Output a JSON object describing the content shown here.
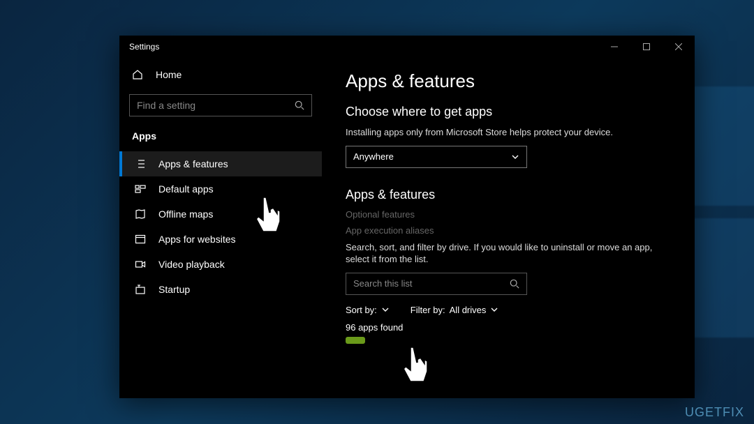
{
  "window": {
    "title": "Settings"
  },
  "sidebar": {
    "home_label": "Home",
    "search_placeholder": "Find a setting",
    "category": "Apps",
    "items": [
      {
        "label": "Apps & features"
      },
      {
        "label": "Default apps"
      },
      {
        "label": "Offline maps"
      },
      {
        "label": "Apps for websites"
      },
      {
        "label": "Video playback"
      },
      {
        "label": "Startup"
      }
    ]
  },
  "main": {
    "title": "Apps & features",
    "where_heading": "Choose where to get apps",
    "where_desc": "Installing apps only from Microsoft Store helps protect your device.",
    "where_value": "Anywhere",
    "list_heading": "Apps & features",
    "optional_link": "Optional features",
    "alias_link": "App execution aliases",
    "list_desc": "Search, sort, and filter by drive. If you would like to uninstall or move an app, select it from the list.",
    "list_search_placeholder": "Search this list",
    "sort_label": "Sort by:",
    "filter_label": "Filter by:",
    "filter_value": "All drives",
    "count": "96 apps found"
  },
  "watermark": "UGETFIX"
}
